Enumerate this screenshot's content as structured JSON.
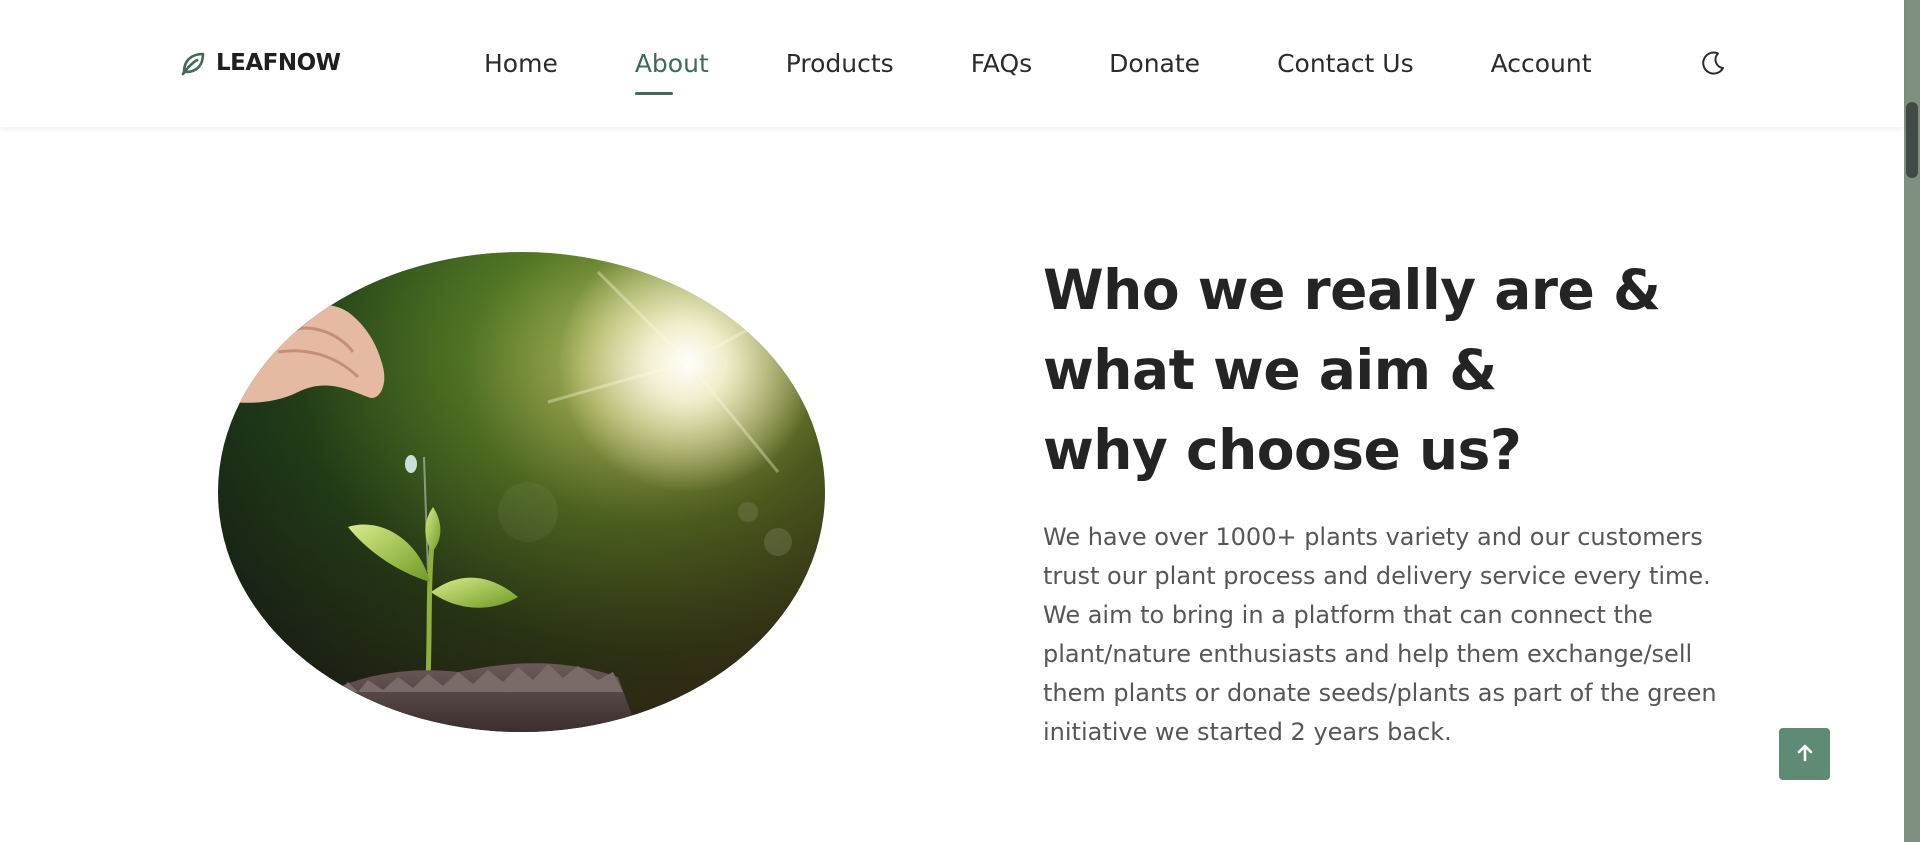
{
  "brand": {
    "name": "LEAFNOW",
    "icon": "leaf-icon",
    "color": "#3d6b55"
  },
  "nav": {
    "items": [
      {
        "label": "Home",
        "active": false
      },
      {
        "label": "About",
        "active": true
      },
      {
        "label": "Products",
        "active": false
      },
      {
        "label": "FAQs",
        "active": false
      },
      {
        "label": "Donate",
        "active": false
      },
      {
        "label": "Contact Us",
        "active": false
      },
      {
        "label": "Account",
        "active": false
      }
    ],
    "theme_toggle_icon": "moon-icon"
  },
  "about": {
    "headline_lines": [
      "Who we really are &",
      "what we aim &",
      "why choose us?"
    ],
    "description": "We have over 1000+ plants variety and our customers trust our plant process and delivery service every time. We aim to bring in a platform that can connect the plant/nature enthusiasts and help them exchange/sell them plants or donate seeds/plants as part of the green initiative we started 2 years back.",
    "image": "hand watering seedling in soil"
  },
  "back_to_top": {
    "icon": "arrow-up-icon",
    "color": "#5f8a74"
  }
}
